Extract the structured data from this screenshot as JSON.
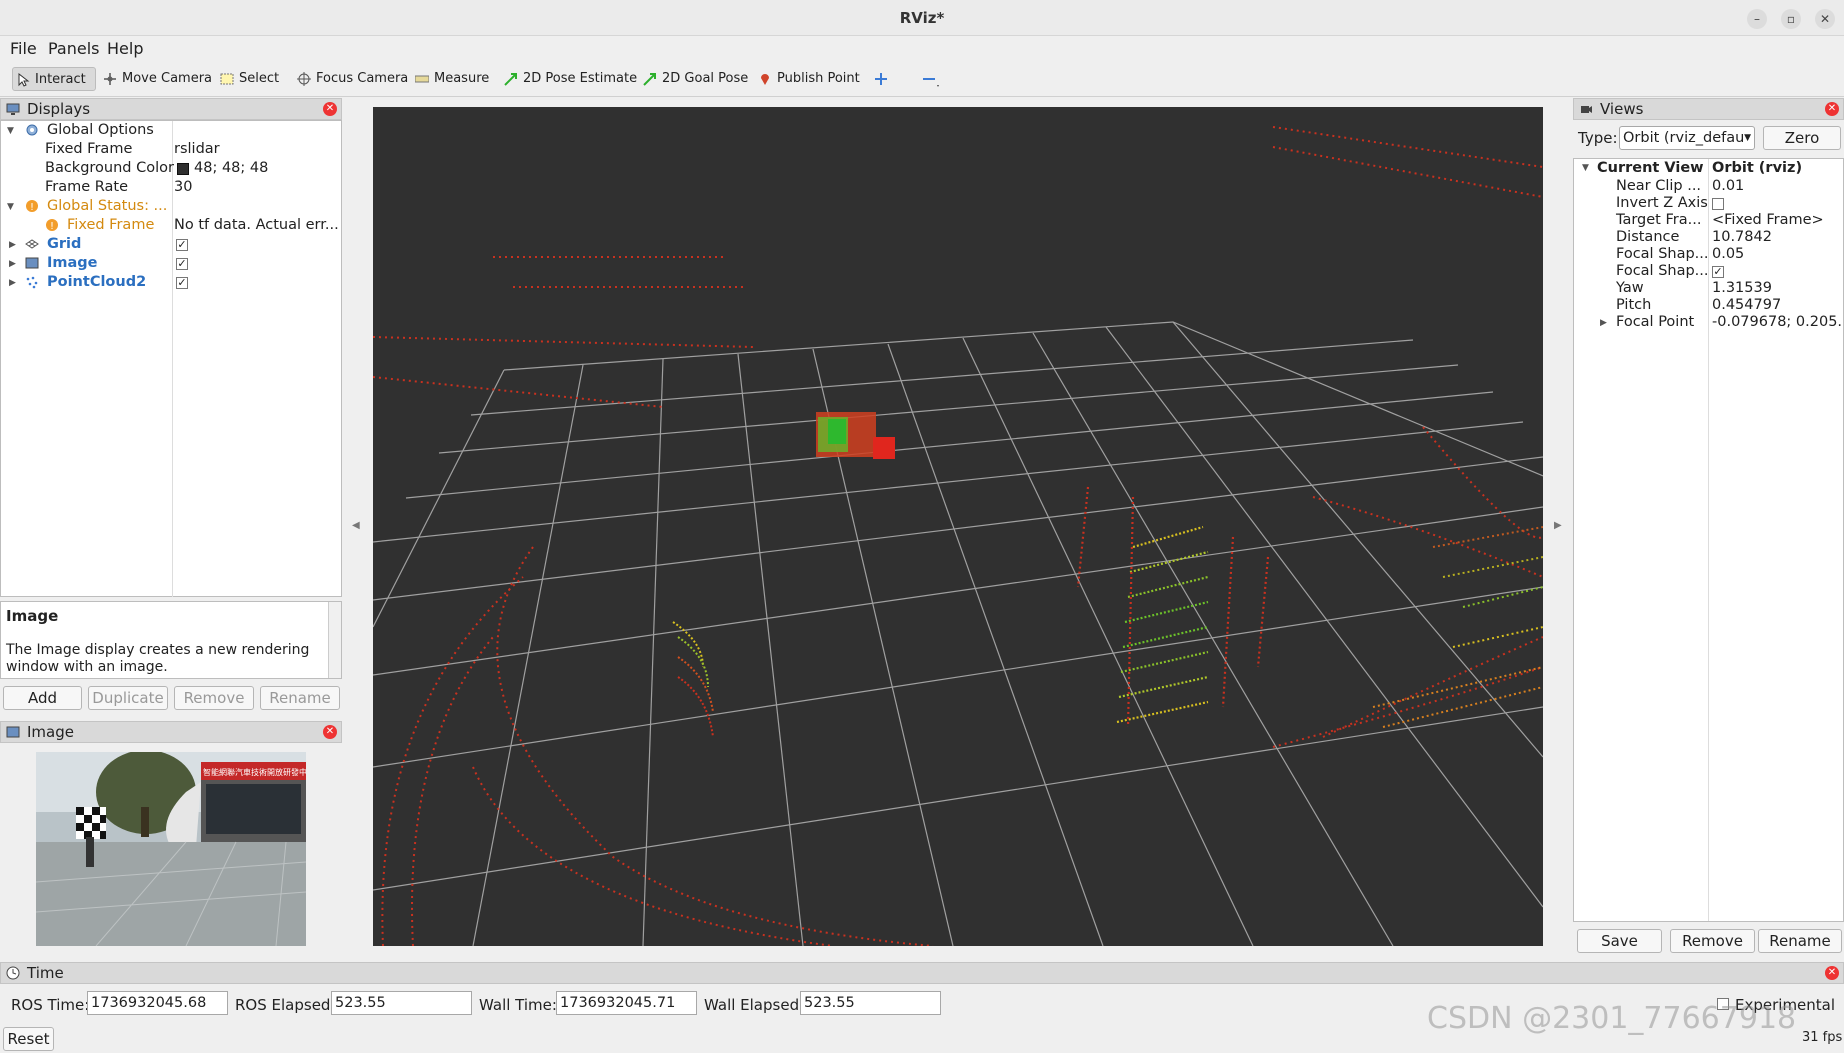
{
  "window": {
    "title": "RViz*"
  },
  "menu": {
    "file": "File",
    "panels": "Panels",
    "help": "Help"
  },
  "toolbar": {
    "interact": "Interact",
    "move_camera": "Move Camera",
    "select": "Select",
    "focus_camera": "Focus Camera",
    "measure": "Measure",
    "pose_estimate": "2D Pose Estimate",
    "goal_pose": "2D Goal Pose",
    "publish_point": "Publish Point"
  },
  "displays": {
    "title": "Displays",
    "global_options": "Global Options",
    "fixed_frame_label": "Fixed Frame",
    "fixed_frame_value": "rslidar",
    "bg_color_label": "Background Color",
    "bg_color_value": "48; 48; 48",
    "bg_color_hex": "#303030",
    "frame_rate_label": "Frame Rate",
    "frame_rate_value": "30",
    "global_status": "Global Status: ...",
    "status_fixed_frame": "Fixed Frame",
    "status_message": "No tf data.  Actual err...",
    "grid": "Grid",
    "image": "Image",
    "pointcloud": "PointCloud2",
    "desc_title": "Image",
    "desc_text": "The Image display creates a new rendering window with an image.",
    "add": "Add",
    "duplicate": "Duplicate",
    "remove": "Remove",
    "rename": "Rename"
  },
  "image_panel": {
    "title": "Image",
    "sign_text": "智能網聯汽車技術開放研發中心 電子信息學院"
  },
  "views": {
    "title": "Views",
    "type_label": "Type:",
    "type_value": "Orbit (rviz_defau",
    "zero": "Zero",
    "current_view": "Current View",
    "current_view_value": "Orbit (rviz)",
    "props": [
      {
        "name": "Near Clip ...",
        "value": "0.01"
      },
      {
        "name": "Invert Z Axis",
        "value": ""
      },
      {
        "name": "Target Fra...",
        "value": "<Fixed Frame>"
      },
      {
        "name": "Distance",
        "value": "10.7842"
      },
      {
        "name": "Focal Shap...",
        "value": "0.05"
      },
      {
        "name": "Focal Shap...",
        "value": ""
      },
      {
        "name": "Yaw",
        "value": "1.31539"
      },
      {
        "name": "Pitch",
        "value": "0.454797"
      },
      {
        "name": "Focal Point",
        "value": "-0.079678; 0.205..."
      }
    ],
    "save": "Save",
    "remove": "Remove",
    "rename": "Rename"
  },
  "time": {
    "title": "Time",
    "ros_time_label": "ROS Time:",
    "ros_time": "1736932045.68",
    "ros_elapsed_label": "ROS Elapsed:",
    "ros_elapsed": "523.55",
    "wall_time_label": "Wall Time:",
    "wall_time": "1736932045.71",
    "wall_elapsed_label": "Wall Elapsed:",
    "wall_elapsed": "523.55",
    "experimental": "Experimental",
    "reset": "Reset",
    "fps": "31 fps"
  },
  "watermark": "CSDN @2301_77667918"
}
